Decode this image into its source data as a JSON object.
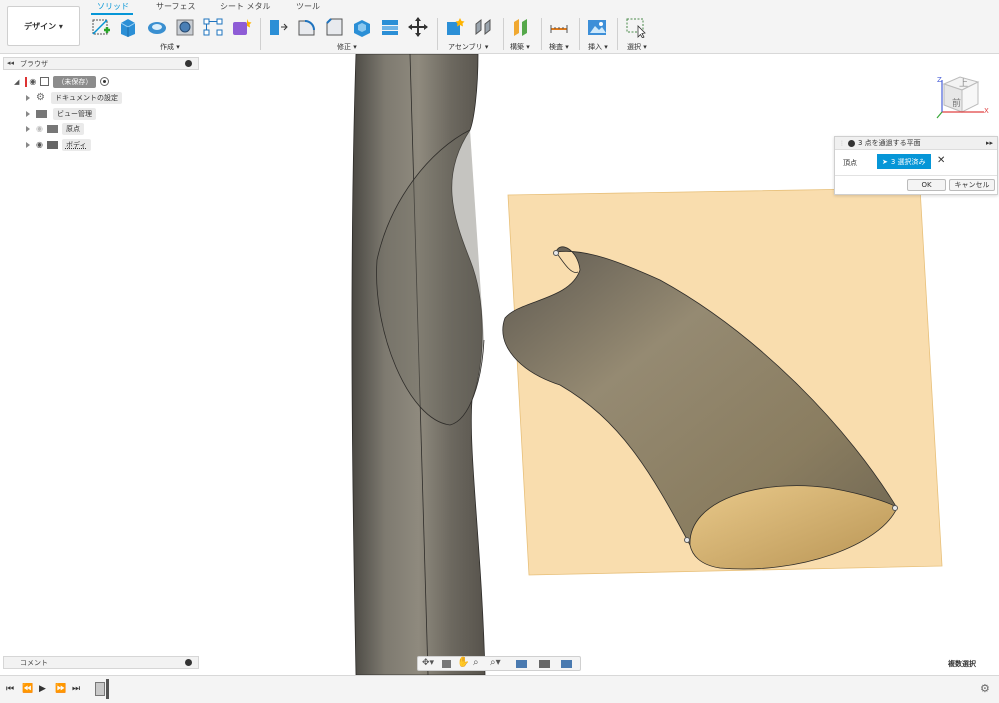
{
  "toolbar": {
    "workspace_button": "デザイン ▾",
    "tabs": [
      "ソリッド",
      "サーフェス",
      "シート メタル",
      "ツール"
    ],
    "groups": [
      "作成 ▾",
      "修正 ▾",
      "アセンブリ ▾",
      "構築 ▾",
      "検査 ▾",
      "挿入 ▾",
      "選択 ▾"
    ]
  },
  "browser": {
    "title": "ブラウザ",
    "root": "（未保存）",
    "items": [
      "ドキュメントの設定",
      "ビュー管理",
      "原点",
      "ボディ"
    ]
  },
  "comments": {
    "title": "コメント"
  },
  "viewcube": {
    "top": "上",
    "front": "前",
    "axis_x": "X",
    "axis_z": "Z"
  },
  "panel": {
    "title": "3 点を通過する平面",
    "field_label": "頂点",
    "selection": "3 選択済み",
    "ok": "OK",
    "cancel": "キャンセル"
  },
  "status": {
    "multi_select": "複数選択"
  },
  "colors": {
    "accent": "#0696d7",
    "plane": "#f7d59a",
    "body": "#6b655a"
  }
}
